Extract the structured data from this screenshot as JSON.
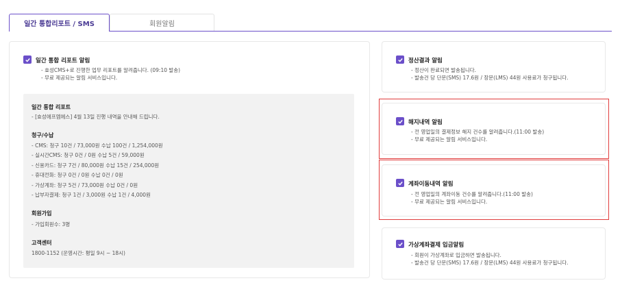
{
  "tabs": [
    {
      "label": "일간 통합리포트 / SMS",
      "active": true
    },
    {
      "label": "회원알림",
      "active": false
    }
  ],
  "colors": {
    "accent": "#6b4fc9",
    "highlight_border": "#e03c3c"
  },
  "left": {
    "title": "일간 통합 리포트 알림",
    "desc": [
      "- 효성CMS+로 진행한 업무 리포트를 알려줍니다. (09:10 발송)",
      "- 무료 제공되는 알림 서비스입니다."
    ],
    "preview": {
      "daily_title": "일간 통합 리포트",
      "daily_line": "- [효성에프엠에스] 4월 13일 진행 내역을 안내해 드립니다.",
      "billing_title": "청구/수납",
      "billing_lines": [
        "- CMS: 청구 10건 / 73,000원   수납 100건 / 1,254,000원",
        "- 실시간CMS: 청구 0건 / 0원   수납 5건 / 59,000원",
        "- 신용카드: 청구 7건 / 80,000원   수납 15건 / 254,000원",
        "- 휴대전화: 청구 0건 / 0원   수납 0건 / 0원",
        "- 가상계좌: 청구 5건 / 73,000원   수납 0건 / 0원",
        "- 납부자결제: 청구 1건 / 3,000원   수납 1건 / 4,000원"
      ],
      "member_title": "회원가입",
      "member_line": "- 가입회원수: 3명",
      "cs_title": "고객센터",
      "cs_line": "1800-1152 (운영시간: 평일 9시 ~ 18시)"
    }
  },
  "right": [
    {
      "title": "정산결과 알림",
      "desc": [
        "- 정산이 완료되면 발송됩니다.",
        "- 발송건 당 단문(SMS) 17.6원 / 장문(LMS) 44원 사용료가 청구됩니다."
      ]
    },
    {
      "title": "해지내역 알림",
      "desc": [
        "- 전 영업일의 결제정보 해지 건수를 알려줍니다.(11:00 발송)",
        "- 무료 제공되는 알림 서비스입니다."
      ]
    },
    {
      "title": "계좌이동내역 알림",
      "desc": [
        "- 전 영업일의 계좌이동 건수를 알려줍니다.(11:00 발송)",
        "- 무료 제공되는 알림 서비스입니다."
      ]
    },
    {
      "title": "가상계좌결제 입금알림",
      "desc": [
        "- 회원이 가상계좌로 입금하면 발송됩니다.",
        "- 발송건 당 단문(SMS) 17.6원 / 장문(LMS) 44원 사용료가 청구됩니다."
      ]
    }
  ]
}
